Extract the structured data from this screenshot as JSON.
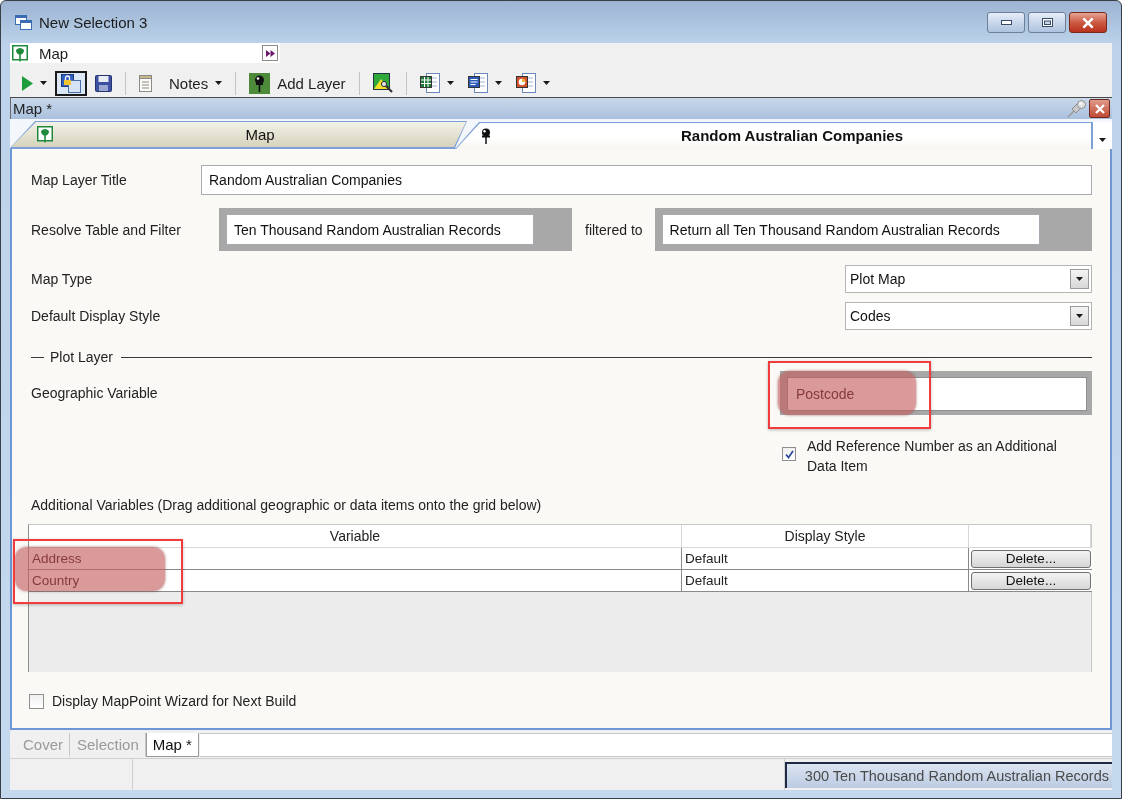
{
  "window": {
    "title": "New Selection 3"
  },
  "document_bar": {
    "title": "Map"
  },
  "toolbar": [
    {
      "kind": "button",
      "pressed": false,
      "menu": true
    },
    {
      "kind": "button",
      "pressed": true,
      "menu": false
    },
    {
      "kind": "button",
      "pressed": false,
      "menu": false
    },
    {
      "kind": "separator"
    },
    {
      "kind": "button",
      "label": "Notes",
      "pressed": false,
      "menu": true
    },
    {
      "kind": "separator"
    },
    {
      "kind": "button",
      "label": "Add Layer",
      "pressed": false,
      "menu": false
    },
    {
      "kind": "separator"
    },
    {
      "kind": "button",
      "pressed": false,
      "menu": false
    },
    {
      "kind": "separator"
    },
    {
      "kind": "button",
      "pressed": false,
      "menu": true
    },
    {
      "kind": "button",
      "pressed": false,
      "menu": true
    },
    {
      "kind": "button",
      "pressed": false,
      "menu": true
    }
  ],
  "panel": {
    "title": "Map *"
  },
  "tabs": [
    {
      "label": "Map",
      "selected": false
    },
    {
      "label": "Random Australian Companies",
      "selected": true
    }
  ],
  "map_layer_title": {
    "label": "Map Layer Title",
    "value": "Random Australian Companies"
  },
  "resolve_table": {
    "label": "Resolve Table and Filter",
    "table": "Ten Thousand Random Australian Records",
    "connector": "filtered to",
    "filter": "Return all Ten Thousand Random Australian Records"
  },
  "map_type": {
    "label": "Map Type",
    "value": "Plot Map"
  },
  "default_display_style": {
    "label": "Default Display Style",
    "value": "Codes"
  },
  "plot_layer": {
    "title": "Plot Layer",
    "geographic_variable": {
      "label": "Geographic Variable",
      "value": "Postcode",
      "highlighted": true
    },
    "add_reference": {
      "label": "Add Reference Number as an Additional Data Item",
      "checked": true
    }
  },
  "additional_variables": {
    "label": "Additional Variables (Drag additional geographic or data items onto the grid below)",
    "columns": [
      "Variable",
      "Display Style"
    ],
    "rows": [
      {
        "variable": "Address",
        "display_style": "Default",
        "action": "Delete...",
        "highlighted": true
      },
      {
        "variable": "Country",
        "display_style": "Default",
        "action": "Delete...",
        "highlighted": true
      }
    ]
  },
  "wizard_option": {
    "label": "Display MapPoint Wizard for Next Build",
    "checked": false
  },
  "sheet_tabs": [
    {
      "label": "Cover",
      "selected": false
    },
    {
      "label": "Selection",
      "selected": false
    },
    {
      "label": "Map *",
      "selected": true
    }
  ],
  "status_bar": {
    "record_count": "300 Ten Thousand Random Australian Records"
  }
}
